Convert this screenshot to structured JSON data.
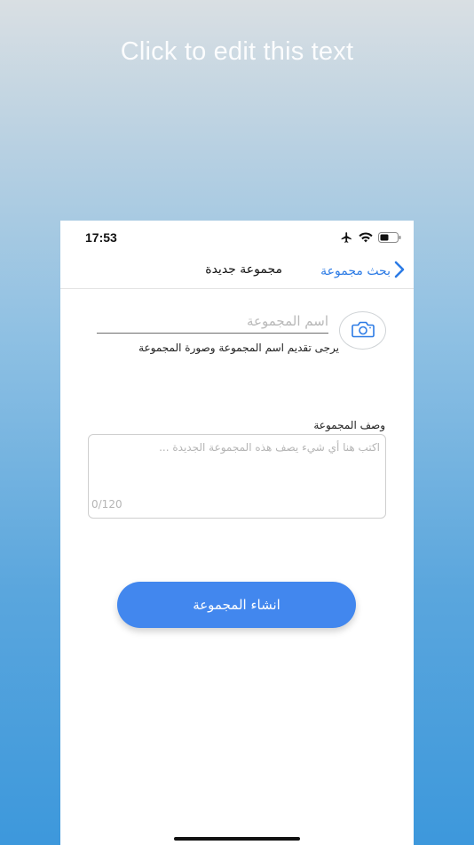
{
  "promo": {
    "text": "Click to edit this text"
  },
  "status_bar": {
    "time": "17:53",
    "icons": [
      "airplane-icon",
      "wifi-icon",
      "battery-icon"
    ]
  },
  "nav": {
    "back_label": "بحث مجموعة",
    "title": "مجموعة جديدة",
    "back_icon": "chevron-right-icon"
  },
  "form": {
    "camera_icon": "camera-icon",
    "name_placeholder": "اسم المجموعة",
    "name_value": "",
    "hint": "يرجى تقديم اسم المجموعة وصورة المجموعة",
    "description_label": "وصف المجموعة",
    "description_placeholder": "اكتب هنا أي شيء يصف هذه المجموعة الجديدة ...",
    "description_value": "",
    "char_counter": "0/120"
  },
  "actions": {
    "create_label": "انشاء المجموعة"
  },
  "colors": {
    "accent": "#4287ee",
    "link": "#2c7be5"
  }
}
